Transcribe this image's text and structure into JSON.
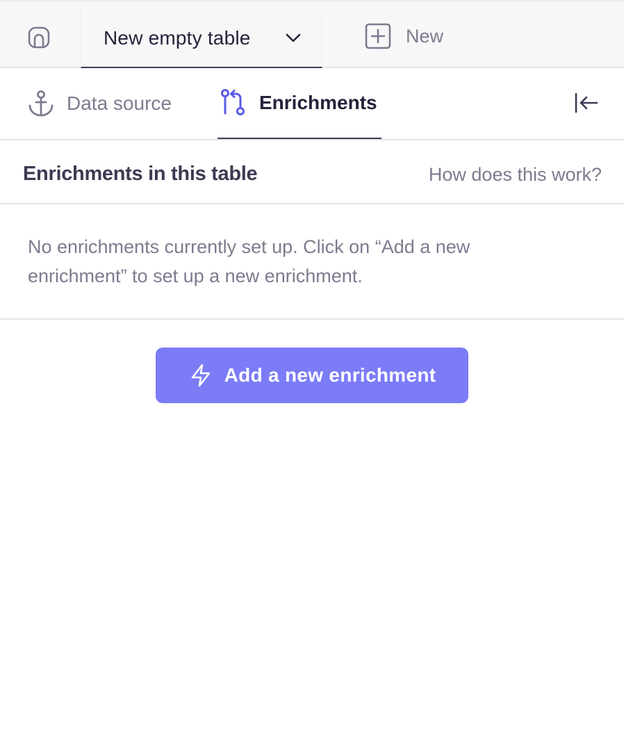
{
  "topbar": {
    "home_icon": "home-arch-icon",
    "table_tab": {
      "label": "New empty table",
      "icon": "chevron-down-icon"
    },
    "new_button": {
      "label": "New",
      "icon": "plus-square-icon"
    }
  },
  "tabs": [
    {
      "label": "Data source",
      "icon": "anchor-icon",
      "active": false
    },
    {
      "label": "Enrichments",
      "icon": "git-pull-request-icon",
      "active": true
    }
  ],
  "collapse_icon": "collapse-left-icon",
  "section": {
    "title": "Enrichments in this table",
    "help_link": "How does this work?"
  },
  "empty_state": {
    "message": "No enrichments currently set up. Click on “Add a new enrichment” to set up a new enrichment."
  },
  "add_button": {
    "label": "Add a new enrichment",
    "icon": "lightning-icon"
  },
  "colors": {
    "accent": "#7b7cf6",
    "accent_icon": "#5a5ce6",
    "text_dark": "#23233a",
    "text_muted": "#7b7c8f",
    "border": "#e4e4e7"
  }
}
